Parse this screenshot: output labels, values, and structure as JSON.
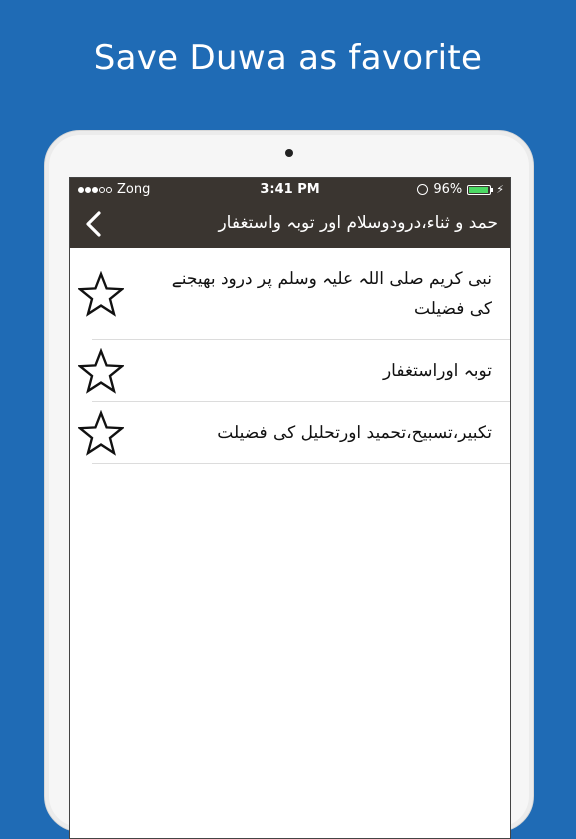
{
  "promo": {
    "headline": "Save Duwa as favorite"
  },
  "status_bar": {
    "carrier": "Zong",
    "time": "3:41 PM",
    "battery_percent": "96%",
    "battery_level": 0.96,
    "signal_bars": 3,
    "signal_max": 5
  },
  "nav": {
    "back_icon": "chevron-left-icon",
    "title": "حمد و ثناء،درودوسلام اور توبہ واستغفار"
  },
  "list": {
    "items": [
      {
        "label": "نبی کریم صلی اللہ علیہ وسلم پر درود بھیجنے کی فضیلت",
        "icon": "star-outline-icon"
      },
      {
        "label": "توبہ اوراستغفار",
        "icon": "star-outline-icon"
      },
      {
        "label": "تکبیر،تسبیح،تحمید اورتحلیل کی فضیلت",
        "icon": "star-outline-icon"
      }
    ]
  },
  "colors": {
    "background": "#1f6bb5",
    "bar": "#3a3530",
    "battery": "#4cd964"
  }
}
